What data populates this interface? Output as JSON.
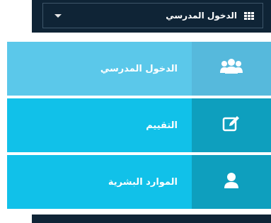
{
  "header": {
    "dropdown_label": "الدخول المدرسي",
    "grid_icon": "grid-icon",
    "caret_icon": "caret-down-icon"
  },
  "menu": {
    "items": [
      {
        "label": "الدخول المدرسي",
        "icon": "users-group-icon"
      },
      {
        "label": "التقييم",
        "icon": "edit-icon"
      },
      {
        "label": "الموارد البشرية",
        "icon": "user-icon"
      }
    ]
  },
  "colors": {
    "dark_bar": "#0f2436",
    "active_item": "#5bc8ea",
    "active_icon_bg": "#56b9dc",
    "item": "#11c1e9",
    "item_icon_bg": "#0e9fbe"
  }
}
